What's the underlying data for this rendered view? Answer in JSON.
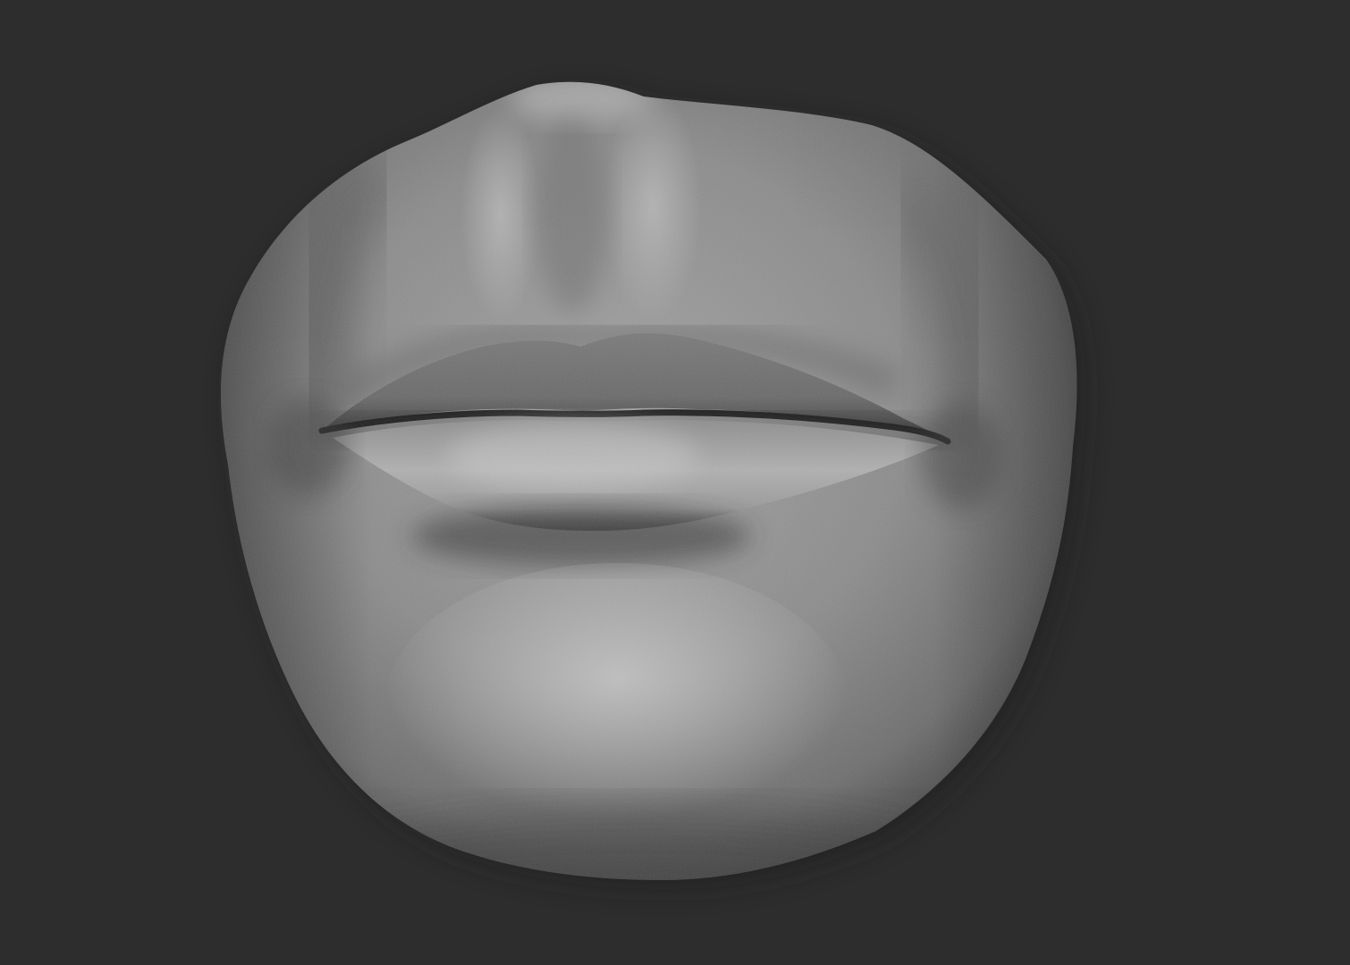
{
  "scene": {
    "subject_icon": "sculpted-mouth-model",
    "colors": {
      "background": "#2d2d2d",
      "clay_base": "#8a8a8a",
      "clay_highlight": "#c4c4c4",
      "clay_shadow": "#3e3e3e",
      "lip_seam": "#1c1c1c"
    }
  }
}
